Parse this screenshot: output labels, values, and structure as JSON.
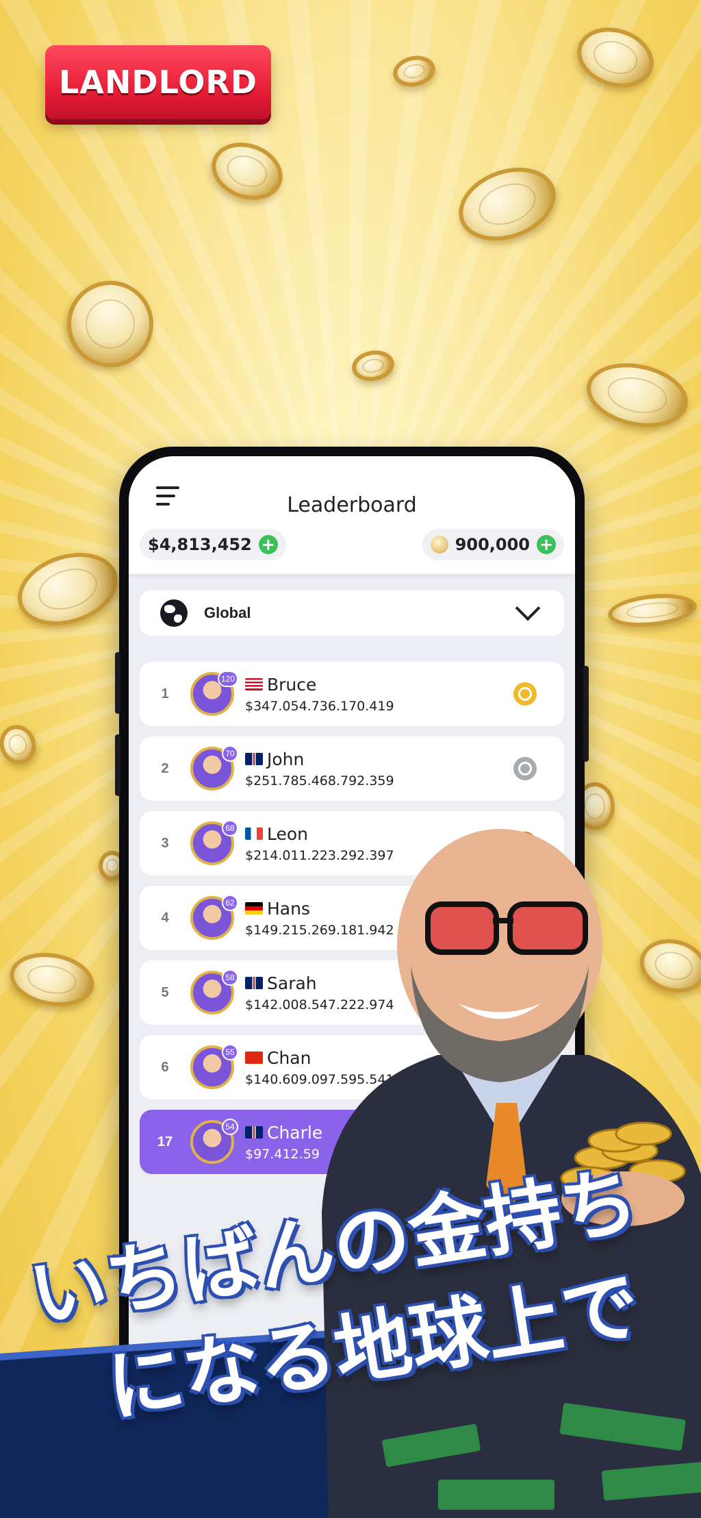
{
  "brand": {
    "logo_text": "LANDLORD"
  },
  "app": {
    "title": "Leaderboard",
    "cash": "$4,813,452",
    "coins": "900,000",
    "filter": {
      "selected": "Global"
    }
  },
  "leaderboard": [
    {
      "rank": "1",
      "level": "120",
      "flag": "us",
      "name": "Bruce",
      "money": "$347.054.736.170.419",
      "medal": "gold"
    },
    {
      "rank": "2",
      "level": "70",
      "flag": "gb",
      "name": "John",
      "money": "$251.785.468.792.359",
      "medal": "silver"
    },
    {
      "rank": "3",
      "level": "68",
      "flag": "fr",
      "name": "Leon",
      "money": "$214.011.223.292.397",
      "medal": "bronze"
    },
    {
      "rank": "4",
      "level": "62",
      "flag": "de",
      "name": "Hans",
      "money": "$149.215.269.181.942"
    },
    {
      "rank": "5",
      "level": "58",
      "flag": "gb",
      "name": "Sarah",
      "money": "$142.008.547.222.974"
    },
    {
      "rank": "6",
      "level": "55",
      "flag": "cn",
      "name": "Chan",
      "money": "$140.609.097.595.541"
    },
    {
      "rank": "17",
      "level": "54",
      "flag": "gb",
      "name": "Charle",
      "money": "$97.412.59",
      "current_user": true
    }
  ],
  "headline": {
    "line1": "いちばんの金持ち",
    "line2": "になる地球上で"
  },
  "colors": {
    "accent": "#8b63ea",
    "plus_green": "#39c25a",
    "logo_red": "#e81e37",
    "banner_navy": "#10275a"
  }
}
